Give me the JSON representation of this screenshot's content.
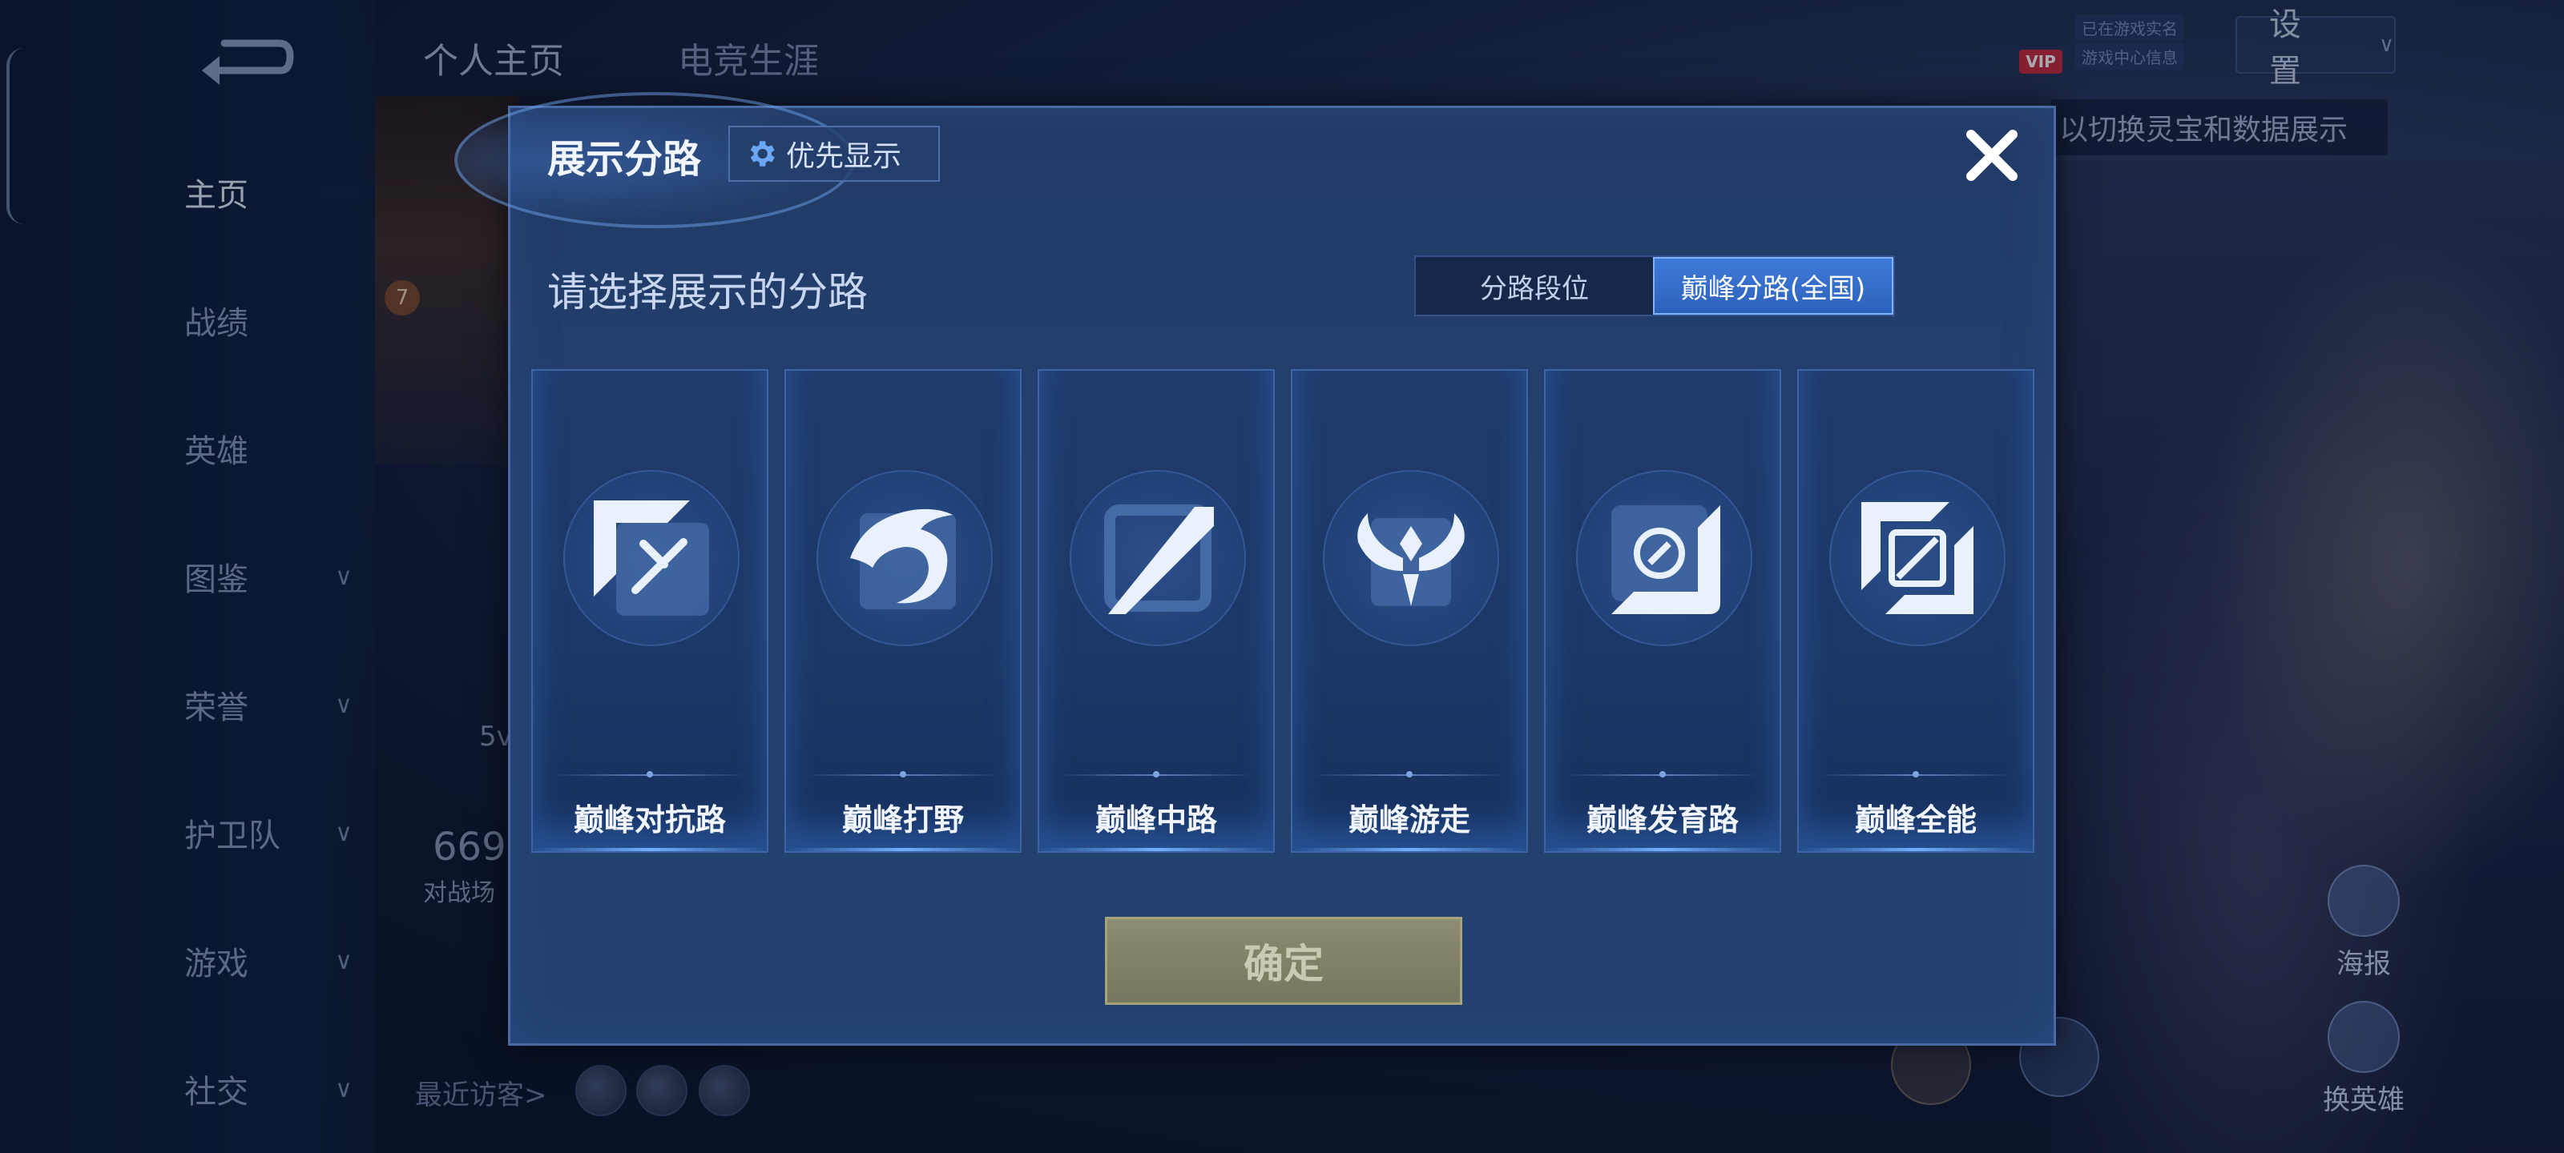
{
  "background": {
    "sidebar": {
      "items": [
        {
          "label": "主页",
          "has_chevron": false,
          "active": true
        },
        {
          "label": "战绩",
          "has_chevron": false
        },
        {
          "label": "英雄",
          "has_chevron": false
        },
        {
          "label": "图鉴",
          "has_chevron": true
        },
        {
          "label": "荣誉",
          "has_chevron": true
        },
        {
          "label": "护卫队",
          "has_chevron": true
        },
        {
          "label": "游戏",
          "has_chevron": true
        },
        {
          "label": "社交",
          "has_chevron": true
        }
      ]
    },
    "tabs": [
      "个人主页",
      "电竞生涯"
    ],
    "settings_label": "设置",
    "vip": {
      "badge": "VIP",
      "line1": "已在游戏实名",
      "line2": "游戏中心信息"
    },
    "tip_text": "以切换灵宝和数据展示",
    "level": "7",
    "partial_text_5v": "5v",
    "partial_text_count": "669",
    "partial_text_label": "对战场",
    "recent_visitors": "最近访客>",
    "hero_buttons": {
      "poster": "海报",
      "switch_hero": "换英雄"
    }
  },
  "modal": {
    "title": "展示分路",
    "priority_button": "优先显示",
    "subtitle": "请选择展示的分路",
    "segment": {
      "options": [
        "分路段位",
        "巅峰分路(全国)"
      ],
      "selected": "巅峰分路(全国)"
    },
    "lanes": [
      {
        "label": "巅峰对抗路",
        "icon": "clash-lane-icon"
      },
      {
        "label": "巅峰打野",
        "icon": "jungle-icon"
      },
      {
        "label": "巅峰中路",
        "icon": "mid-lane-icon"
      },
      {
        "label": "巅峰游走",
        "icon": "roam-icon"
      },
      {
        "label": "巅峰发育路",
        "icon": "farm-lane-icon"
      },
      {
        "label": "巅峰全能",
        "icon": "all-round-icon"
      }
    ],
    "confirm_button": "确定"
  },
  "colors": {
    "modal_bg": "#233f6d",
    "segment_active": "#3570cc",
    "confirm_bg": "#85846a"
  }
}
